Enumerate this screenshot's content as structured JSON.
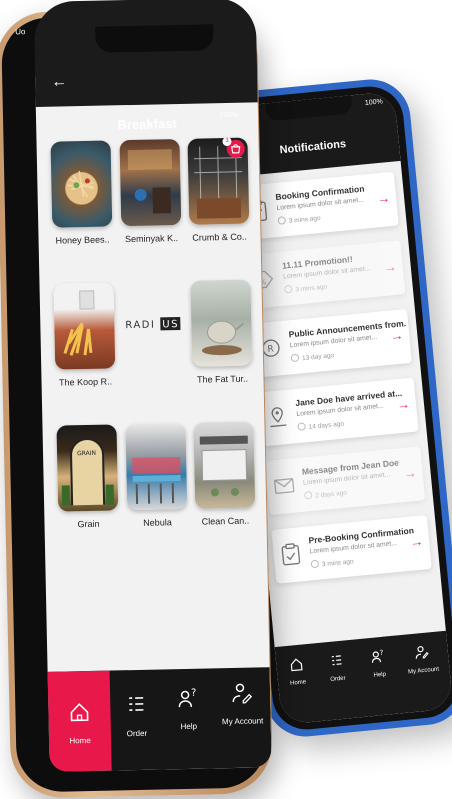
{
  "accent_color": "#e8194a",
  "back_phone": {
    "status_left": "Uo",
    "status_right": "100%",
    "title": "Notifications",
    "notifications": [
      {
        "title": "Booking Confirmation",
        "body": "Lorem ipsum dolor sit amet...",
        "time": "3 mins ago",
        "icon": "clipboard-icon",
        "read": false
      },
      {
        "title": "11.11 Promotion!!",
        "body": "Lorem ipsum dolor sit amet...",
        "time": "3 mins ago",
        "icon": "discount-tag-icon",
        "read": true
      },
      {
        "title": "Public Announcements from..",
        "body": "Lorem ipsum dolor sit amet...",
        "time": "13 day ago",
        "icon": "announcement-icon",
        "read": false
      },
      {
        "title": "Jane Doe have arrived at...",
        "body": "Lorem ipsum dolor sit amet...",
        "time": "14 days ago",
        "icon": "location-pin-icon",
        "read": false
      },
      {
        "title": "Message from Jean Doe",
        "body": "Lorem ipsum dolor sit amet...",
        "time": "2 days ago",
        "icon": "envelope-icon",
        "read": true
      },
      {
        "title": "Pre-Booking Confirmation",
        "body": "Lorem ipsum dolor sit amet...",
        "time": "3 mins ago",
        "icon": "clipboard-icon",
        "read": false
      }
    ],
    "nav": [
      {
        "label": "Home"
      },
      {
        "label": "Order"
      },
      {
        "label": "Help"
      },
      {
        "label": "My Account"
      }
    ]
  },
  "front_phone": {
    "status_left": "Uo",
    "status_right": "100%",
    "title": "Breakfast",
    "cart_count": "3",
    "restaurants": [
      {
        "name": "Honey Bees.."
      },
      {
        "name": "Seminyak K.."
      },
      {
        "name": "Crumb & Co.."
      },
      {
        "name": "The Koop R.."
      },
      {
        "name": "",
        "logo_text": "RADIUS"
      },
      {
        "name": "The Fat Tur.."
      },
      {
        "name": "Grain",
        "sign_text": "GRAIN"
      },
      {
        "name": "Nebula"
      },
      {
        "name": "Clean Can.."
      }
    ],
    "nav": [
      {
        "label": "Home",
        "active": true
      },
      {
        "label": "Order"
      },
      {
        "label": "Help"
      },
      {
        "label": "My Account"
      }
    ]
  }
}
